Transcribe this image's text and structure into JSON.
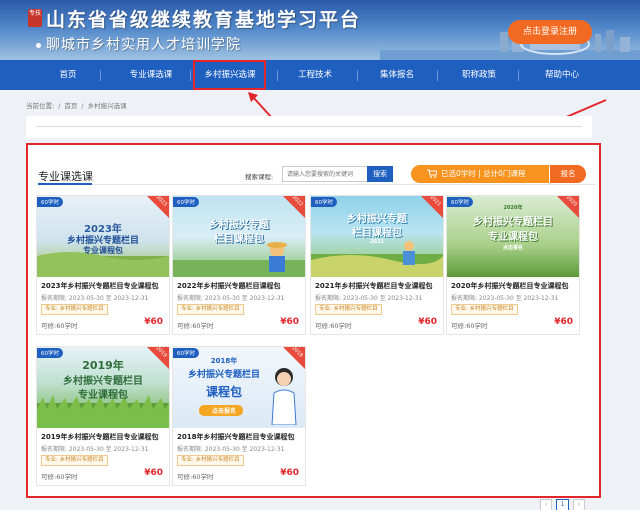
{
  "header": {
    "stamp": "专技",
    "title": "山东省省级继续教育基地学习平台",
    "subtitle": "聊城市乡村实用人才培训学院",
    "login_button": "点击登录注册"
  },
  "nav": {
    "items": [
      {
        "label": "首页"
      },
      {
        "label": "专业课选课"
      },
      {
        "label": "乡村振兴选课"
      },
      {
        "label": "工程技术"
      },
      {
        "label": "集体报名"
      },
      {
        "label": "职称政策"
      },
      {
        "label": "帮助中心"
      }
    ],
    "active_index": 2
  },
  "breadcrumb": {
    "prefix": "当前位置:",
    "home": "首页",
    "current": "乡村振兴选课"
  },
  "section": {
    "title": "专业课选课",
    "search_label": "搜索课程:",
    "search_placeholder": "请输入您要搜索的关键词",
    "search_button": "搜索",
    "cart_text": "已选0学时 | 总计0门课程",
    "enroll_button": "报名"
  },
  "cards": [
    {
      "hours": "60学时",
      "year": "2023",
      "thumb_lines": [
        "2023年",
        "乡村振兴专题栏目",
        "专业课程包"
      ],
      "name": "2023年乡村振兴专题栏目专业课程包",
      "period": "报名期限: 2023-05-30 至 2023-12-31",
      "specialty": "专业: 乡村振兴专题栏目",
      "credit": "可修:60学时",
      "price": "¥60"
    },
    {
      "hours": "60学时",
      "year": "2022",
      "thumb_lines": [
        "乡村振兴专题",
        "栏目课程包"
      ],
      "name": "2022年乡村振兴专题栏目课程包",
      "period": "报名期限: 2023-05-30 至 2023-12-31",
      "specialty": "专业: 乡村振兴专题栏目",
      "credit": "可修:60学时",
      "price": "¥60"
    },
    {
      "hours": "60学时",
      "year": "2021",
      "thumb_lines": [
        "乡村振兴专题",
        "栏目课程包",
        "2021"
      ],
      "name": "2021年乡村振兴专题栏目专业课程包",
      "period": "报名期限: 2023-05-30 至 2023-12-31",
      "specialty": "专业: 乡村振兴专题栏目",
      "credit": "可修:60学时",
      "price": "¥60"
    },
    {
      "hours": "60学时",
      "year": "2020",
      "thumb_lines": [
        "2020年",
        "乡村振兴专题栏目",
        "专业课程包",
        "点击报名"
      ],
      "name": "2020年乡村振兴专题栏目专业课程包",
      "period": "报名期限: 2023-05-30 至 2023-12-31",
      "specialty": "专业: 乡村振兴专题栏目",
      "credit": "可修:60学时",
      "price": "¥60"
    },
    {
      "hours": "60学时",
      "year": "2019",
      "thumb_lines": [
        "2019年",
        "乡村振兴专题栏目",
        "专业课程包"
      ],
      "name": "2019年乡村振兴专题栏目专业课程包",
      "period": "报名期限: 2023-05-30 至 2023-12-31",
      "specialty": "专业: 乡村振兴专题栏目",
      "credit": "可修:60学时",
      "price": "¥60"
    },
    {
      "hours": "60学时",
      "year": "2018",
      "thumb_lines": [
        "2018年",
        "乡村振兴专题栏目",
        "课程包",
        "点击报名"
      ],
      "name": "2018年乡村振兴专题栏目专业课程包",
      "period": "报名期限: 2023-05-30 至 2023-12-31",
      "specialty": "专业: 乡村振兴专题栏目",
      "credit": "可修:60学时",
      "price": "¥60"
    }
  ],
  "pagination": {
    "prev": "‹",
    "current": "1",
    "next": "›"
  },
  "colors": {
    "brand_blue": "#1e5fbf",
    "accent_orange": "#f26a21",
    "annotation_red": "#e2262b",
    "price_red": "#e2262b"
  }
}
